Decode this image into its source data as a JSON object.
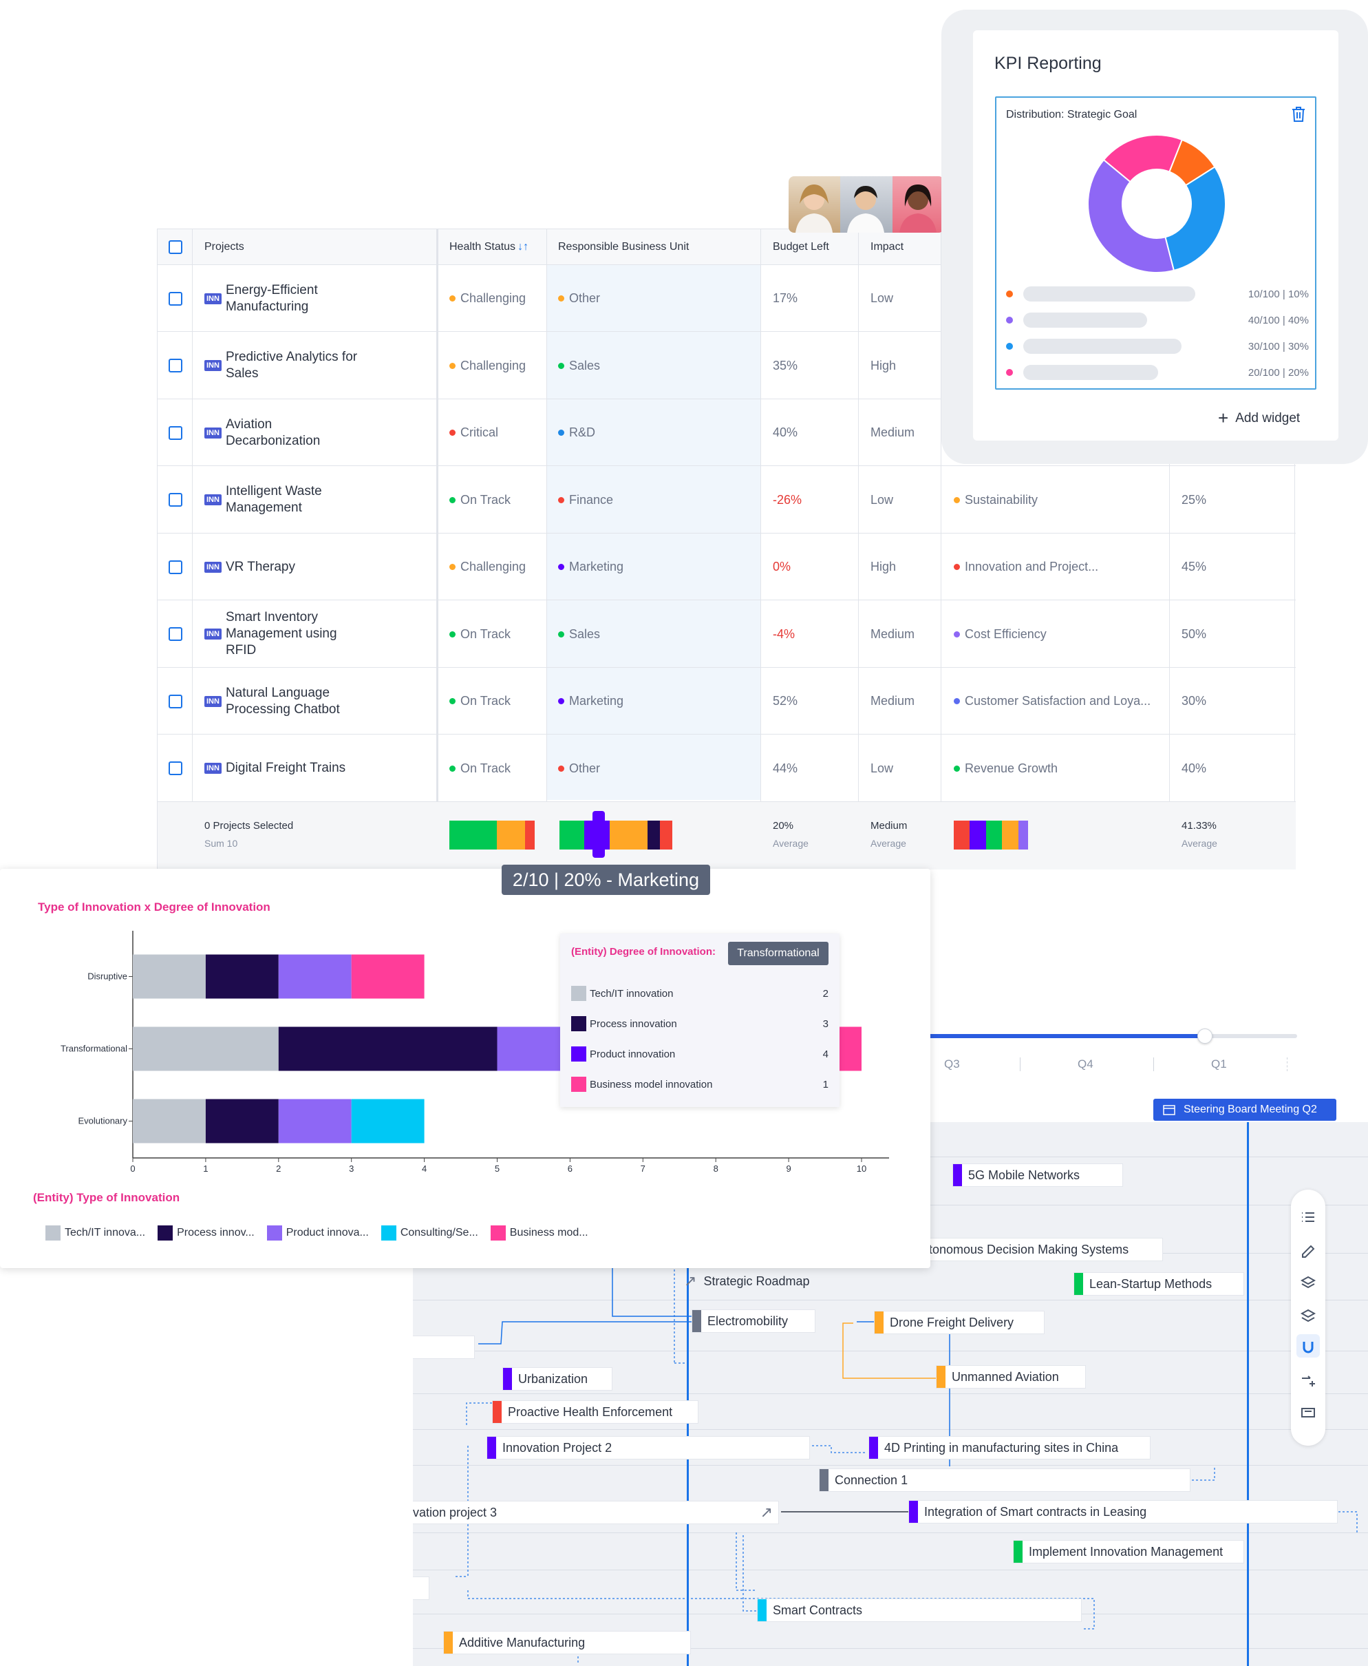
{
  "kpi": {
    "title": "KPI Reporting",
    "widget_title": "Distribution: Strategic Goal",
    "add_widget": "Add widget",
    "colors": [
      "#ff6b1a",
      "#8e67f5",
      "#1e96f0",
      "#ff3d99"
    ],
    "legend": [
      {
        "label": "10/100 | 10%",
        "color": "#ff6b1a"
      },
      {
        "label": "40/100 | 40%",
        "color": "#8e67f5"
      },
      {
        "label": "30/100 | 30%",
        "color": "#1e96f0"
      },
      {
        "label": "20/100 | 20%",
        "color": "#ff3d99"
      }
    ]
  },
  "chart_data": [
    {
      "type": "pie",
      "title": "Distribution: Strategic Goal",
      "values": [
        10,
        40,
        30,
        20
      ],
      "colors": [
        "#ff6b1a",
        "#8e67f5",
        "#1e96f0",
        "#ff3d99"
      ],
      "donut": true
    },
    {
      "type": "bar",
      "orientation": "horizontal",
      "stacked": true,
      "title": "Type of Innovation x Degree of Innovation",
      "categories": [
        "Disruptive",
        "Transformational",
        "Evolutionary"
      ],
      "series": [
        {
          "name": "Tech/IT innova...",
          "color": "#bfc6cf",
          "values": [
            1,
            2,
            1
          ]
        },
        {
          "name": "Process innov...",
          "color": "#1e0b4d",
          "values": [
            1,
            3,
            1
          ]
        },
        {
          "name": "Product innova...",
          "color": "#8e67f5",
          "values": [
            1,
            4,
            1
          ]
        },
        {
          "name": "Consulting/Se...",
          "color": "#00c8f5",
          "values": [
            0,
            0,
            1
          ]
        },
        {
          "name": "Business mod...",
          "color": "#ff3d99",
          "values": [
            1,
            1,
            0
          ]
        }
      ],
      "xlim": [
        0,
        10
      ],
      "xticks": [
        "0",
        "1",
        "2",
        "3",
        "4",
        "5",
        "6",
        "7",
        "8",
        "9",
        "10"
      ],
      "legend_title": "(Entity) Type of Innovation"
    }
  ],
  "table": {
    "headers": {
      "projects": "Projects",
      "health": "Health Status",
      "health_sort": "↓↑",
      "unit": "Responsible Business Unit",
      "budget": "Budget Left",
      "impact": "Impact"
    },
    "inn_tag": "INN",
    "rows": [
      {
        "name": "Energy-Efficient Manufacturing",
        "health": "Challenging",
        "health_color": "#ffa726",
        "unit": "Other",
        "unit_color": "#ffa726",
        "budget": "17%",
        "budget_neg": false,
        "impact": "Low",
        "goal": "",
        "goal_color": "",
        "pct": ""
      },
      {
        "name": "Predictive Analytics for Sales",
        "health": "Challenging",
        "health_color": "#ffa726",
        "unit": "Sales",
        "unit_color": "#00c853",
        "budget": "35%",
        "budget_neg": false,
        "impact": "High",
        "goal": "",
        "goal_color": "",
        "pct": ""
      },
      {
        "name": "Aviation Decarbonization",
        "health": "Critical",
        "health_color": "#f44336",
        "unit": "R&D",
        "unit_color": "#1e88e5",
        "budget": "40%",
        "budget_neg": false,
        "impact": "Medium",
        "goal": "",
        "goal_color": "",
        "pct": ""
      },
      {
        "name": "Intelligent Waste Management",
        "health": "On Track",
        "health_color": "#00c853",
        "unit": "Finance",
        "unit_color": "#f44336",
        "budget": "-26%",
        "budget_neg": true,
        "impact": "Low",
        "goal": "Sustainability",
        "goal_color": "#ffa726",
        "pct": "25%"
      },
      {
        "name": "VR Therapy",
        "health": "Challenging",
        "health_color": "#ffa726",
        "unit": "Marketing",
        "unit_color": "#5b00ff",
        "budget": "0%",
        "budget_neg": true,
        "impact": "High",
        "goal": "Innovation and Project...",
        "goal_color": "#f44336",
        "pct": "45%"
      },
      {
        "name": "Smart Inventory Management using RFID",
        "health": "On Track",
        "health_color": "#00c853",
        "unit": "Sales",
        "unit_color": "#00c853",
        "budget": "-4%",
        "budget_neg": true,
        "impact": "Medium",
        "goal": "Cost Efficiency",
        "goal_color": "#8e67f5",
        "pct": "50%"
      },
      {
        "name": "Natural Language Processing Chatbot",
        "health": "On Track",
        "health_color": "#00c853",
        "unit": "Marketing",
        "unit_color": "#5b00ff",
        "budget": "52%",
        "budget_neg": false,
        "impact": "Medium",
        "goal": "Customer Satisfaction and Loya...",
        "goal_color": "#5b6cf0",
        "pct": "30%"
      },
      {
        "name": "Digital Freight Trains",
        "health": "On Track",
        "health_color": "#00c853",
        "unit": "Other",
        "unit_color": "#f44336",
        "budget": "44%",
        "budget_neg": false,
        "impact": "Low",
        "goal": "Revenue Growth",
        "goal_color": "#00c853",
        "pct": "40%"
      }
    ],
    "footer": {
      "selected": "0 Projects Selected",
      "sum": "Sum 10",
      "budget": "20%",
      "budget_sub": "Average",
      "impact": "Medium",
      "impact_sub": "Average",
      "pct": "41.33%",
      "pct_sub": "Average"
    },
    "health_dist": [
      {
        "color": "#00c853",
        "value": 5
      },
      {
        "color": "#ffa726",
        "value": 3
      },
      {
        "color": "#f44336",
        "value": 1
      }
    ],
    "unit_dist": [
      {
        "color": "#00c853",
        "value": 2
      },
      {
        "color": "#5b00ff",
        "value": 2
      },
      {
        "color": "#ffa726",
        "value": 3
      },
      {
        "color": "#1e0b4d",
        "value": 1
      },
      {
        "color": "#f44336",
        "value": 1
      }
    ],
    "goal_dist": [
      {
        "color": "#f44336",
        "value": 1
      },
      {
        "color": "#5b00ff",
        "value": 1
      },
      {
        "color": "#00c853",
        "value": 1
      },
      {
        "color": "#ffa726",
        "value": 1
      },
      {
        "color": "#8e67f5",
        "value": 0.6
      }
    ],
    "tooltip": "2/10 | 20% - Marketing"
  },
  "bar_chart_ui": {
    "popup_title": "(Entity) Degree of Innovation:",
    "popup_badge": "Transformational",
    "popup_items": [
      {
        "label": "Tech/IT innovation",
        "value": "2",
        "color": "#bfc6cf"
      },
      {
        "label": "Process innovation",
        "value": "3",
        "color": "#1e0b4d"
      },
      {
        "label": "Product innovation",
        "value": "4",
        "color": "#5b00ff"
      },
      {
        "label": "Business model innovation",
        "value": "1",
        "color": "#ff3d99"
      }
    ]
  },
  "roadmap": {
    "quarters": [
      "Q3",
      "Q4",
      "Q1"
    ],
    "milestone": "Steering Board Meeting Q2",
    "items": [
      {
        "label": "5G Mobile Networks",
        "color": "#5b00ff"
      },
      {
        "label": "tonomous Decision Making Systems",
        "color": ""
      },
      {
        "label": "Lean-Startup Methods",
        "color": "#00c853"
      },
      {
        "label": "Strategic Roadmap",
        "color": ""
      },
      {
        "label": "Electromobility",
        "color": "#6b7385"
      },
      {
        "label": "Drone Freight Delivery",
        "color": "#ffa726"
      },
      {
        "label": "Unmanned Aviation",
        "color": "#ffa726"
      },
      {
        "label": "Urbanization",
        "color": "#5b00ff"
      },
      {
        "label": "Proactive Health Enforcement",
        "color": "#f44336"
      },
      {
        "label": "Innovation Project 2",
        "color": "#5b00ff"
      },
      {
        "label": "4D Printing in manufacturing sites in China",
        "color": "#5b00ff"
      },
      {
        "label": "Connection 1",
        "color": "#6b7385"
      },
      {
        "label": "vation project 3",
        "color": ""
      },
      {
        "label": "Integration of Smart contracts in Leasing",
        "color": "#5b00ff"
      },
      {
        "label": "Implement Innovation Management",
        "color": "#00c853"
      },
      {
        "label": "Smart Contracts",
        "color": "#00c8f5"
      },
      {
        "label": "Additive Manufacturing",
        "color": "#ffa726"
      }
    ]
  }
}
